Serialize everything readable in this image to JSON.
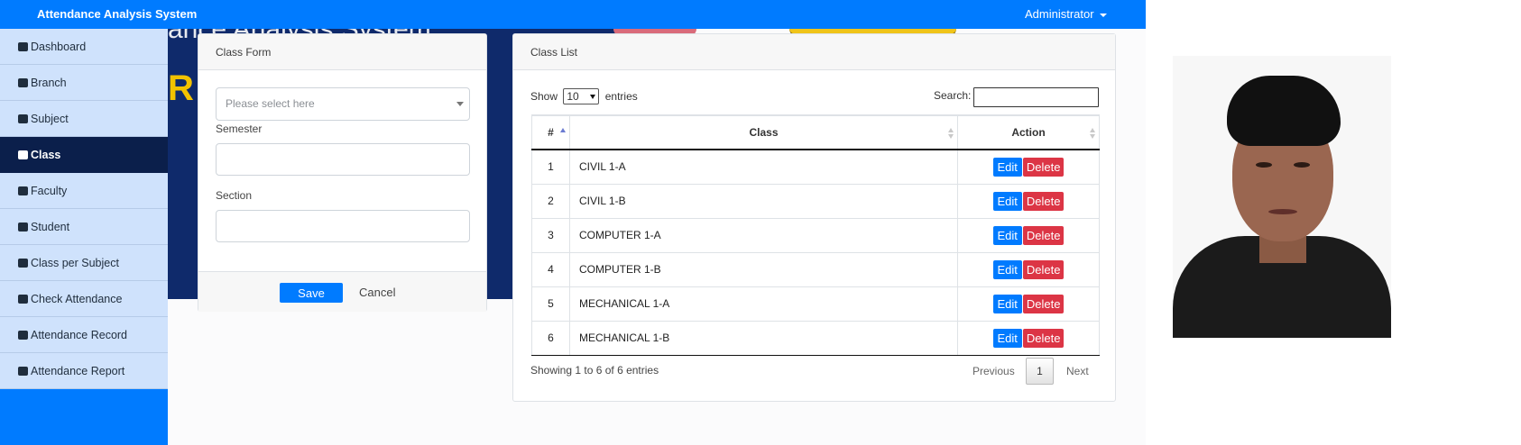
{
  "topbar": {
    "brand": "Attendance Analysis System",
    "user": "Administrator"
  },
  "banner": {
    "text": "ance Analysis System",
    "text2": "R",
    "colors": {
      "navy": "#0f2a6b",
      "gold": "#f2c200"
    }
  },
  "sidebar": {
    "items": [
      {
        "label": "Dashboard",
        "icon": "gauge-icon",
        "active": false
      },
      {
        "label": "Branch",
        "icon": "list-icon",
        "active": false
      },
      {
        "label": "Subject",
        "icon": "book-icon",
        "active": false
      },
      {
        "label": "Class",
        "icon": "table-icon",
        "active": true
      },
      {
        "label": "Faculty",
        "icon": "user-tie-icon",
        "active": false
      },
      {
        "label": "Student",
        "icon": "users-icon",
        "active": false
      },
      {
        "label": "Class per Subject",
        "icon": "users-icon",
        "active": false
      },
      {
        "label": "Check Attendance",
        "icon": "list-check-icon",
        "active": false
      },
      {
        "label": "Attendance Record",
        "icon": "list-check-icon",
        "active": false
      },
      {
        "label": "Attendance Report",
        "icon": "list-check-icon",
        "active": false
      }
    ]
  },
  "form": {
    "title": "Class Form",
    "select_placeholder": "Please select here",
    "semester_label": "Semester",
    "semester_value": "",
    "section_label": "Section",
    "section_value": "",
    "save_label": "Save",
    "cancel_label": "Cancel"
  },
  "list": {
    "title": "Class List",
    "show_prefix": "Show",
    "show_value": "10",
    "show_suffix": "entries",
    "search_label": "Search:",
    "search_value": "",
    "columns": [
      "#",
      "Class",
      "Action"
    ],
    "rows": [
      {
        "num": "1",
        "class": "CIVIL 1-A"
      },
      {
        "num": "2",
        "class": "CIVIL 1-B"
      },
      {
        "num": "3",
        "class": "COMPUTER 1-A"
      },
      {
        "num": "4",
        "class": "COMPUTER 1-B"
      },
      {
        "num": "5",
        "class": "MECHANICAL 1-A"
      },
      {
        "num": "6",
        "class": "MECHANICAL 1-B"
      }
    ],
    "edit_label": "Edit",
    "delete_label": "Delete",
    "info": "Showing 1 to 6 of 6 entries",
    "prev_label": "Previous",
    "page": "1",
    "next_label": "Next"
  },
  "colors": {
    "primary": "#007bff",
    "danger": "#dc3545",
    "sidebar_bg": "#cfe2fc",
    "sidebar_active": "#0b1f4b"
  }
}
